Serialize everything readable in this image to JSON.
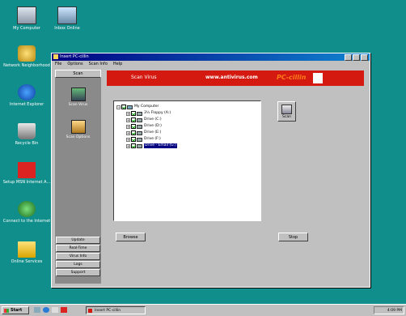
{
  "desktop": {
    "icons": [
      {
        "label": "My Computer",
        "icon": "computer-icon"
      },
      {
        "label": "Inbox Online",
        "icon": "inbox-icon"
      },
      {
        "label": "Network Neighborhood",
        "icon": "network-icon"
      },
      {
        "label": "Internet Explorer",
        "icon": "internet-explorer-icon"
      },
      {
        "label": "Recycle Bin",
        "icon": "recycle-bin-icon"
      },
      {
        "label": "Setup MSN Internet A...",
        "icon": "msn-icon"
      },
      {
        "label": "Connect to the Internet",
        "icon": "online-icon"
      },
      {
        "label": "Online Services",
        "icon": "folder-icon"
      }
    ]
  },
  "window": {
    "title": "Insert PC-cillin",
    "menu": [
      "File",
      "Options",
      "Scan Info",
      "Help"
    ],
    "left_pane": {
      "top_label": "Scan",
      "items": [
        {
          "label": "Scan Virus",
          "icon": "scan-virus-icon"
        },
        {
          "label": "Scan Options",
          "icon": "scan-options-icon"
        }
      ],
      "buttons": [
        "Update",
        "Real-Time",
        "Virus Info",
        "Logs",
        "Support"
      ]
    },
    "banner": {
      "left_text": "Scan Virus",
      "right_text": "www.antivirus.com",
      "logo": "PC-cillin"
    },
    "tree": {
      "nodes": [
        {
          "label": "My Computer"
        },
        {
          "label": "3½ Floppy (A:)"
        },
        {
          "label": "Drive (C:)"
        },
        {
          "label": "Drive (D:)"
        },
        {
          "label": "Drive (E:)"
        },
        {
          "label": "Drive (F:)"
        },
        {
          "label": "Drive - Email (G:)"
        }
      ]
    },
    "scan_button": {
      "label": "Scan",
      "icon": "scan-icon"
    },
    "browse_button": "Browse",
    "stop_button": "Stop"
  },
  "taskbar": {
    "start_label": "Start",
    "task_label": "Insert PC-cillin",
    "clock": "4:09 PM"
  }
}
